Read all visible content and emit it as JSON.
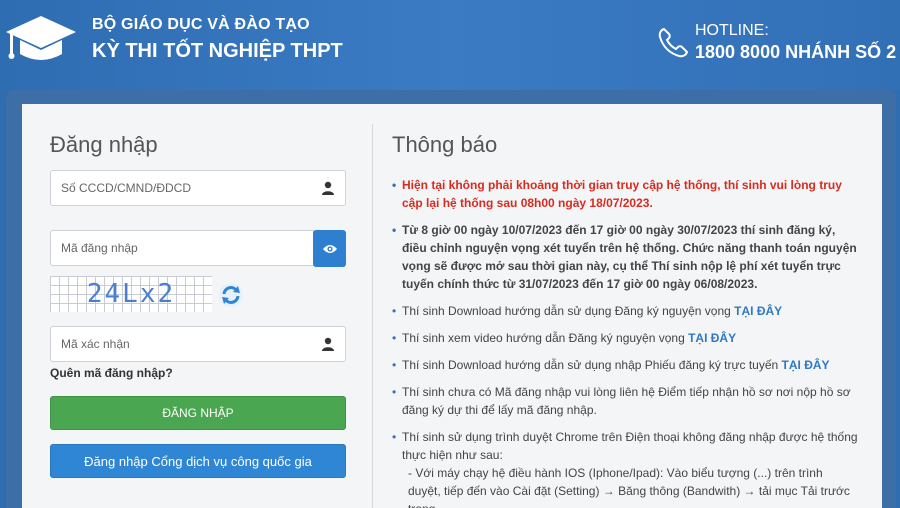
{
  "header": {
    "org": "BỘ GIÁO DỤC VÀ ĐÀO TẠO",
    "exam": "KỲ THI TỐT NGHIỆP THPT",
    "hotline_label": "HOTLINE:",
    "hotline_number": "1800 8000 NHÁNH SỐ 2",
    "logo_icon": "graduation-cap-icon",
    "phone_icon": "phone-icon"
  },
  "login": {
    "title": "Đăng nhập",
    "id_placeholder": "Số CCCD/CMND/ĐDCD",
    "code_placeholder": "Mã đăng nhập",
    "captcha_text": "24Lx2",
    "verify_placeholder": "Mã xác nhận",
    "forgot": "Quên mã đăng nhập?",
    "login_button": "ĐĂNG NHẬP",
    "gov_button": "Đăng nhập Cổng dịch vụ công quốc gia"
  },
  "notices": {
    "title": "Thông báo",
    "items": [
      {
        "text": "Hiện tại không phải khoảng thời gian truy cập hệ thống, thí sinh vui lòng truy cập lại hệ thống sau 08h00 ngày 18/07/2023."
      },
      {
        "text": "Từ 8 giờ 00 ngày 10/07/2023 đến 17 giờ 00 ngày 30/07/2023 thí sinh đăng ký, điều chỉnh nguyện vọng xét tuyển trên hệ thống. Chức năng thanh toán nguyện vọng sẽ được mở sau thời gian này, cụ thể Thí sinh nộp lệ phí xét tuyển trực tuyến chính thức từ 31/07/2023 đến 17 giờ 00 ngày 06/08/2023."
      },
      {
        "text": "Thí sinh Download hướng dẫn sử dụng Đăng ký nguyện vọng",
        "link": "TẠI ĐÂY"
      },
      {
        "text": "Thí sinh xem video hướng dẫn Đăng ký nguyện vọng",
        "link": "TẠI ĐÂY"
      },
      {
        "text": "Thí sinh Download hướng dẫn sử dụng nhập Phiếu đăng ký trực tuyến",
        "link": "TẠI ĐÂY"
      },
      {
        "text": "Thí sinh chưa có Mã đăng nhập vui lòng liên hệ Điểm tiếp nhận hồ sơ nơi nộp hồ sơ đăng ký dự thi để lấy mã đăng nhập."
      },
      {
        "text": "Thí sinh sử dụng trình duyệt Chrome trên Điện thoại không đăng nhập được hệ thống thực hiện như sau:",
        "sub": "- Với máy chạy hệ điều hành IOS (Iphone/Ipad): Vào biểu tượng (...) trên trình duyệt, tiếp đến vào Cài đặt (Setting) → Băng thông (Bandwith) → tải mục Tải trước trang"
      }
    ]
  },
  "colors": {
    "brand_blue": "#2f6db0",
    "login_green": "#4ba651",
    "gov_blue": "#2f86d4",
    "alert_red": "#d92b1f",
    "link_blue": "#2f78c4"
  }
}
